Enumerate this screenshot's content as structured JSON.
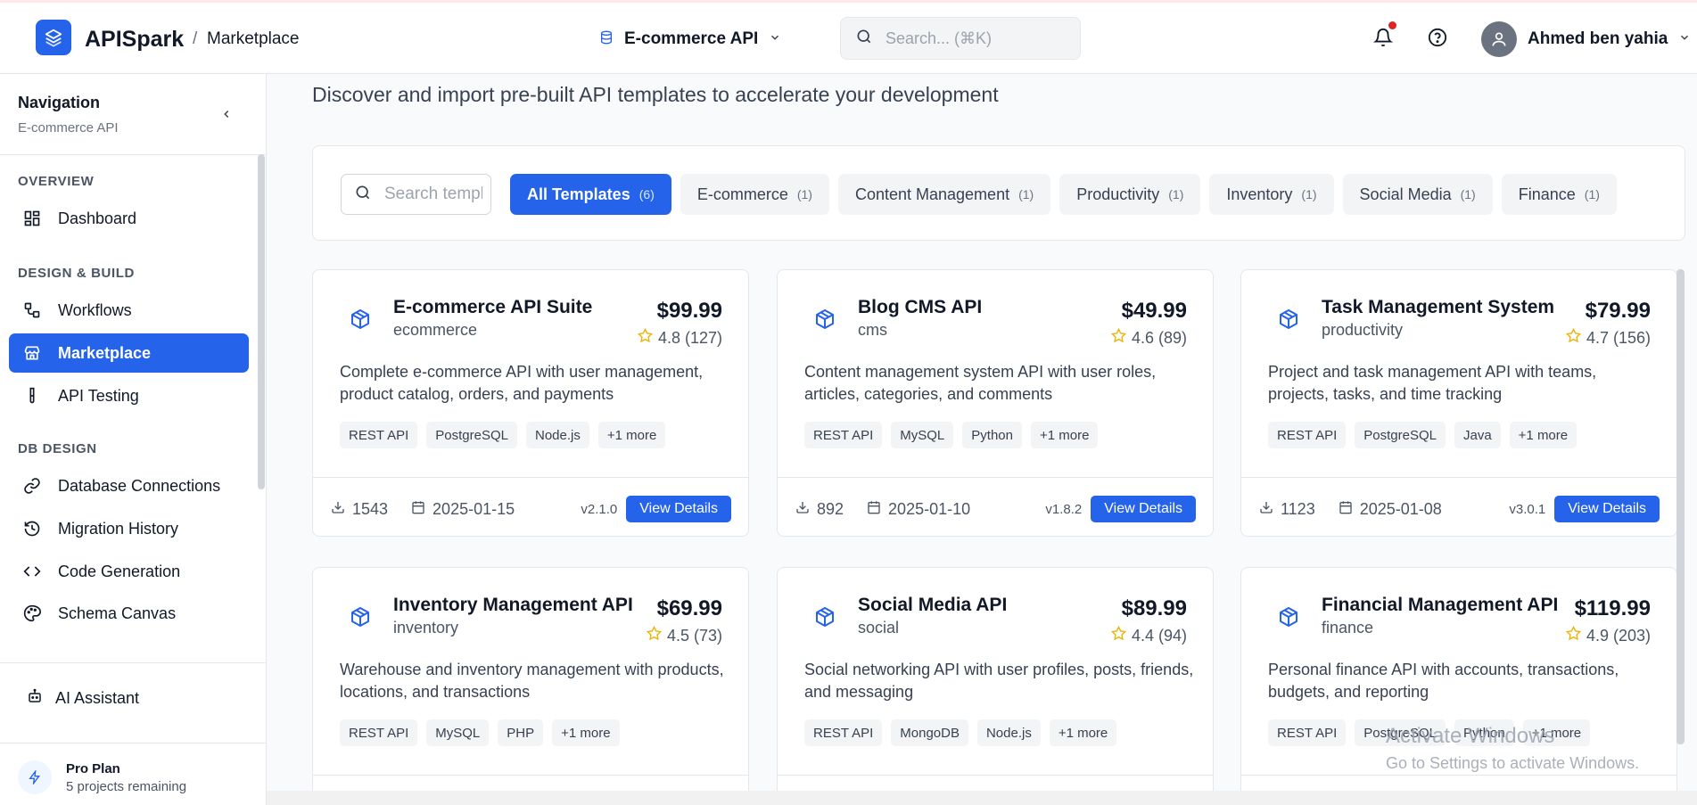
{
  "header": {
    "brand": "APISpark",
    "breadcrumb_sep": "/",
    "breadcrumb": "Marketplace",
    "project": "E-commerce API",
    "search_placeholder": "Search... (⌘K)",
    "user_name": "Ahmed ben yahia"
  },
  "sidebar": {
    "title": "Navigation",
    "subtitle": "E-commerce API",
    "sections": {
      "overview": "OVERVIEW",
      "design_build": "DESIGN & BUILD",
      "db_design": "DB DESIGN"
    },
    "items": {
      "dashboard": "Dashboard",
      "workflows": "Workflows",
      "marketplace": "Marketplace",
      "api_testing": "API Testing",
      "database_connections": "Database Connections",
      "migration_history": "Migration History",
      "code_generation": "Code Generation",
      "schema_canvas": "Schema Canvas"
    },
    "ai_assistant": "AI Assistant",
    "plan_title": "Pro Plan",
    "plan_sub": "5 projects remaining"
  },
  "main": {
    "subtitle": "Discover and import pre-built API templates to accelerate your development",
    "template_search_placeholder": "Search templates...",
    "chips": [
      {
        "label": "All Templates",
        "count": "(6)"
      },
      {
        "label": "E-commerce",
        "count": "(1)"
      },
      {
        "label": "Content Management",
        "count": "(1)"
      },
      {
        "label": "Productivity",
        "count": "(1)"
      },
      {
        "label": "Inventory",
        "count": "(1)"
      },
      {
        "label": "Social Media",
        "count": "(1)"
      },
      {
        "label": "Finance",
        "count": "(1)"
      }
    ],
    "view_details_label": "View Details",
    "cards": [
      {
        "name": "E-commerce API Suite",
        "category": "ecommerce",
        "price": "$99.99",
        "rating": "4.8 (127)",
        "description": "Complete e-commerce API with user management, product catalog, orders, and payments",
        "tags": [
          "REST API",
          "PostgreSQL",
          "Node.js",
          "+1 more"
        ],
        "downloads": "1543",
        "date": "2025-01-15",
        "version": "v2.1.0"
      },
      {
        "name": "Blog CMS API",
        "category": "cms",
        "price": "$49.99",
        "rating": "4.6 (89)",
        "description": "Content management system API with user roles, articles, categories, and comments",
        "tags": [
          "REST API",
          "MySQL",
          "Python",
          "+1 more"
        ],
        "downloads": "892",
        "date": "2025-01-10",
        "version": "v1.8.2"
      },
      {
        "name": "Task Management System",
        "category": "productivity",
        "price": "$79.99",
        "rating": "4.7 (156)",
        "description": "Project and task management API with teams, projects, tasks, and time tracking",
        "tags": [
          "REST API",
          "PostgreSQL",
          "Java",
          "+1 more"
        ],
        "downloads": "1123",
        "date": "2025-01-08",
        "version": "v3.0.1"
      },
      {
        "name": "Inventory Management API",
        "category": "inventory",
        "price": "$69.99",
        "rating": "4.5 (73)",
        "description": "Warehouse and inventory management with products, locations, and transactions",
        "tags": [
          "REST API",
          "MySQL",
          "PHP",
          "+1 more"
        ]
      },
      {
        "name": "Social Media API",
        "category": "social",
        "price": "$89.99",
        "rating": "4.4 (94)",
        "description": "Social networking API with user profiles, posts, friends, and messaging",
        "tags": [
          "REST API",
          "MongoDB",
          "Node.js",
          "+1 more"
        ]
      },
      {
        "name": "Financial Management API",
        "category": "finance",
        "price": "$119.99",
        "rating": "4.9 (203)",
        "description": "Personal finance API with accounts, transactions, budgets, and reporting",
        "tags": [
          "REST API",
          "PostgreSQL",
          "Python",
          "+1 more"
        ]
      }
    ]
  },
  "watermark": {
    "line1": "Activate Windows",
    "line2": "Go to Settings to activate Windows."
  },
  "colors": {
    "accent": "#2563eb",
    "star": "#eab308",
    "notification": "#dc2626"
  }
}
